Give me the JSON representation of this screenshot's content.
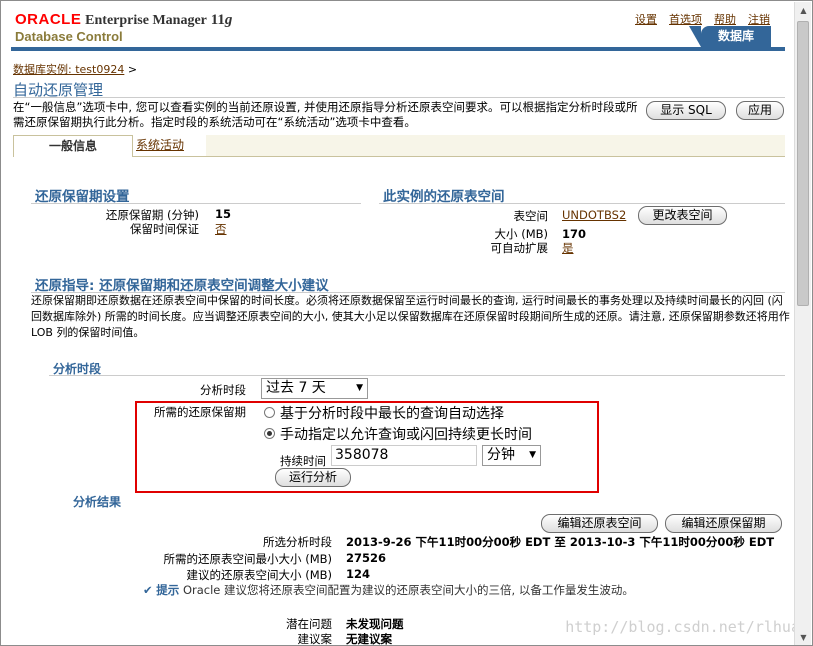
{
  "header": {
    "brand": "ORACLE",
    "product": "Enterprise Manager",
    "version_num": "11",
    "version_g": "g",
    "subtitle": "Database Control",
    "links": [
      "设置",
      "首选项",
      "帮助",
      "注销"
    ],
    "db_tab": "数据库"
  },
  "breadcrumb": {
    "instance_link": "数据库实例: test0924",
    "sep": ">"
  },
  "page": {
    "title": "自动还原管理",
    "description": "在“一般信息”选项卡中, 您可以查看实例的当前还原设置, 并使用还原指导分析还原表空间要求。可以根据指定分析时段或所需还原保留期执行此分析。指定时段的系统活动可在“系统活动”选项卡中查看。",
    "show_sql": "显示 SQL",
    "apply": "应用"
  },
  "tabs": {
    "general": "一般信息",
    "activity": "系统活动"
  },
  "retention": {
    "heading": "还原保留期设置",
    "period_label": "还原保留期 (分钟)",
    "period_value": "15",
    "guarantee_label": "保留时间保证",
    "guarantee_value": "否"
  },
  "tablespace": {
    "heading": "此实例的还原表空间",
    "ts_label": "表空间",
    "ts_value": "UNDOTBS2",
    "change_btn": "更改表空间",
    "size_label": "大小 (MB)",
    "size_value": "170",
    "autoext_label": "可自动扩展",
    "autoext_value": "是"
  },
  "advisor": {
    "heading": "还原指导: 还原保留期和还原表空间调整大小建议",
    "para": "还原保留期即还原数据在还原表空间中保留的时间长度。必须将还原数据保留至运行时间最长的查询, 运行时间最长的事务处理以及持续时间最长的闪回 (闪回数据库除外) 所需的时间长度。应当调整还原表空间的大小, 使其大小足以保留数据库在还原保留时段期间所生成的还原。请注意, 还原保留期参数还将用作 LOB 列的保留时间值。"
  },
  "analysis": {
    "heading": "分析时段",
    "period_label": "分析时段",
    "period_value": "过去 7 天",
    "req_label": "所需的还原保留期",
    "opt_auto": "基于分析时段中最长的查询自动选择",
    "opt_manual": "手动指定以允许查询或闪回持续更长时间",
    "duration_label": "持续时间",
    "duration_value": "358078",
    "unit": "分钟",
    "run_btn": "运行分析"
  },
  "results": {
    "heading": "分析结果",
    "edit_ts_btn": "编辑还原表空间",
    "edit_ret_btn": "编辑还原保留期",
    "sel_period_label": "所选分析时段",
    "sel_period_value": "2013-9-26 下午11时00分00秒 EDT 至 2013-10-3 下午11时00分00秒 EDT",
    "min_size_label": "所需的还原表空间最小大小 (MB)",
    "min_size_value": "27526",
    "rec_size_label": "建议的还原表空间大小 (MB)",
    "rec_size_value": "124",
    "tip_word": "提示",
    "tip_text": "Oracle 建议您将还原表空间配置为建议的还原表空间大小的三倍, 以备工作量发生波动。",
    "problems_label": "潜在问题",
    "problems_value": "未发现问题",
    "recs_label": "建议案",
    "recs_value": "无建议案"
  },
  "watermark": "http://blog.csdn.net/rlhua"
}
